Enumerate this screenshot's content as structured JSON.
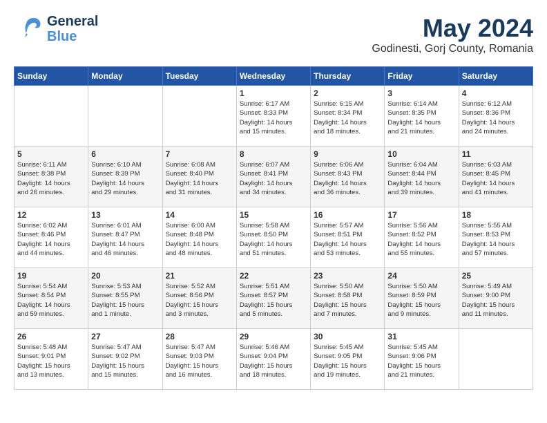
{
  "header": {
    "logo_general": "General",
    "logo_blue": "Blue",
    "month_title": "May 2024",
    "location": "Godinesti, Gorj County, Romania"
  },
  "days_of_week": [
    "Sunday",
    "Monday",
    "Tuesday",
    "Wednesday",
    "Thursday",
    "Friday",
    "Saturday"
  ],
  "weeks": [
    [
      {
        "day": "",
        "content": ""
      },
      {
        "day": "",
        "content": ""
      },
      {
        "day": "",
        "content": ""
      },
      {
        "day": "1",
        "content": "Sunrise: 6:17 AM\nSunset: 8:33 PM\nDaylight: 14 hours\nand 15 minutes."
      },
      {
        "day": "2",
        "content": "Sunrise: 6:15 AM\nSunset: 8:34 PM\nDaylight: 14 hours\nand 18 minutes."
      },
      {
        "day": "3",
        "content": "Sunrise: 6:14 AM\nSunset: 8:35 PM\nDaylight: 14 hours\nand 21 minutes."
      },
      {
        "day": "4",
        "content": "Sunrise: 6:12 AM\nSunset: 8:36 PM\nDaylight: 14 hours\nand 24 minutes."
      }
    ],
    [
      {
        "day": "5",
        "content": "Sunrise: 6:11 AM\nSunset: 8:38 PM\nDaylight: 14 hours\nand 26 minutes."
      },
      {
        "day": "6",
        "content": "Sunrise: 6:10 AM\nSunset: 8:39 PM\nDaylight: 14 hours\nand 29 minutes."
      },
      {
        "day": "7",
        "content": "Sunrise: 6:08 AM\nSunset: 8:40 PM\nDaylight: 14 hours\nand 31 minutes."
      },
      {
        "day": "8",
        "content": "Sunrise: 6:07 AM\nSunset: 8:41 PM\nDaylight: 14 hours\nand 34 minutes."
      },
      {
        "day": "9",
        "content": "Sunrise: 6:06 AM\nSunset: 8:43 PM\nDaylight: 14 hours\nand 36 minutes."
      },
      {
        "day": "10",
        "content": "Sunrise: 6:04 AM\nSunset: 8:44 PM\nDaylight: 14 hours\nand 39 minutes."
      },
      {
        "day": "11",
        "content": "Sunrise: 6:03 AM\nSunset: 8:45 PM\nDaylight: 14 hours\nand 41 minutes."
      }
    ],
    [
      {
        "day": "12",
        "content": "Sunrise: 6:02 AM\nSunset: 8:46 PM\nDaylight: 14 hours\nand 44 minutes."
      },
      {
        "day": "13",
        "content": "Sunrise: 6:01 AM\nSunset: 8:47 PM\nDaylight: 14 hours\nand 46 minutes."
      },
      {
        "day": "14",
        "content": "Sunrise: 6:00 AM\nSunset: 8:48 PM\nDaylight: 14 hours\nand 48 minutes."
      },
      {
        "day": "15",
        "content": "Sunrise: 5:58 AM\nSunset: 8:50 PM\nDaylight: 14 hours\nand 51 minutes."
      },
      {
        "day": "16",
        "content": "Sunrise: 5:57 AM\nSunset: 8:51 PM\nDaylight: 14 hours\nand 53 minutes."
      },
      {
        "day": "17",
        "content": "Sunrise: 5:56 AM\nSunset: 8:52 PM\nDaylight: 14 hours\nand 55 minutes."
      },
      {
        "day": "18",
        "content": "Sunrise: 5:55 AM\nSunset: 8:53 PM\nDaylight: 14 hours\nand 57 minutes."
      }
    ],
    [
      {
        "day": "19",
        "content": "Sunrise: 5:54 AM\nSunset: 8:54 PM\nDaylight: 14 hours\nand 59 minutes."
      },
      {
        "day": "20",
        "content": "Sunrise: 5:53 AM\nSunset: 8:55 PM\nDaylight: 15 hours\nand 1 minute."
      },
      {
        "day": "21",
        "content": "Sunrise: 5:52 AM\nSunset: 8:56 PM\nDaylight: 15 hours\nand 3 minutes."
      },
      {
        "day": "22",
        "content": "Sunrise: 5:51 AM\nSunset: 8:57 PM\nDaylight: 15 hours\nand 5 minutes."
      },
      {
        "day": "23",
        "content": "Sunrise: 5:50 AM\nSunset: 8:58 PM\nDaylight: 15 hours\nand 7 minutes."
      },
      {
        "day": "24",
        "content": "Sunrise: 5:50 AM\nSunset: 8:59 PM\nDaylight: 15 hours\nand 9 minutes."
      },
      {
        "day": "25",
        "content": "Sunrise: 5:49 AM\nSunset: 9:00 PM\nDaylight: 15 hours\nand 11 minutes."
      }
    ],
    [
      {
        "day": "26",
        "content": "Sunrise: 5:48 AM\nSunset: 9:01 PM\nDaylight: 15 hours\nand 13 minutes."
      },
      {
        "day": "27",
        "content": "Sunrise: 5:47 AM\nSunset: 9:02 PM\nDaylight: 15 hours\nand 15 minutes."
      },
      {
        "day": "28",
        "content": "Sunrise: 5:47 AM\nSunset: 9:03 PM\nDaylight: 15 hours\nand 16 minutes."
      },
      {
        "day": "29",
        "content": "Sunrise: 5:46 AM\nSunset: 9:04 PM\nDaylight: 15 hours\nand 18 minutes."
      },
      {
        "day": "30",
        "content": "Sunrise: 5:45 AM\nSunset: 9:05 PM\nDaylight: 15 hours\nand 19 minutes."
      },
      {
        "day": "31",
        "content": "Sunrise: 5:45 AM\nSunset: 9:06 PM\nDaylight: 15 hours\nand 21 minutes."
      },
      {
        "day": "",
        "content": ""
      }
    ]
  ]
}
